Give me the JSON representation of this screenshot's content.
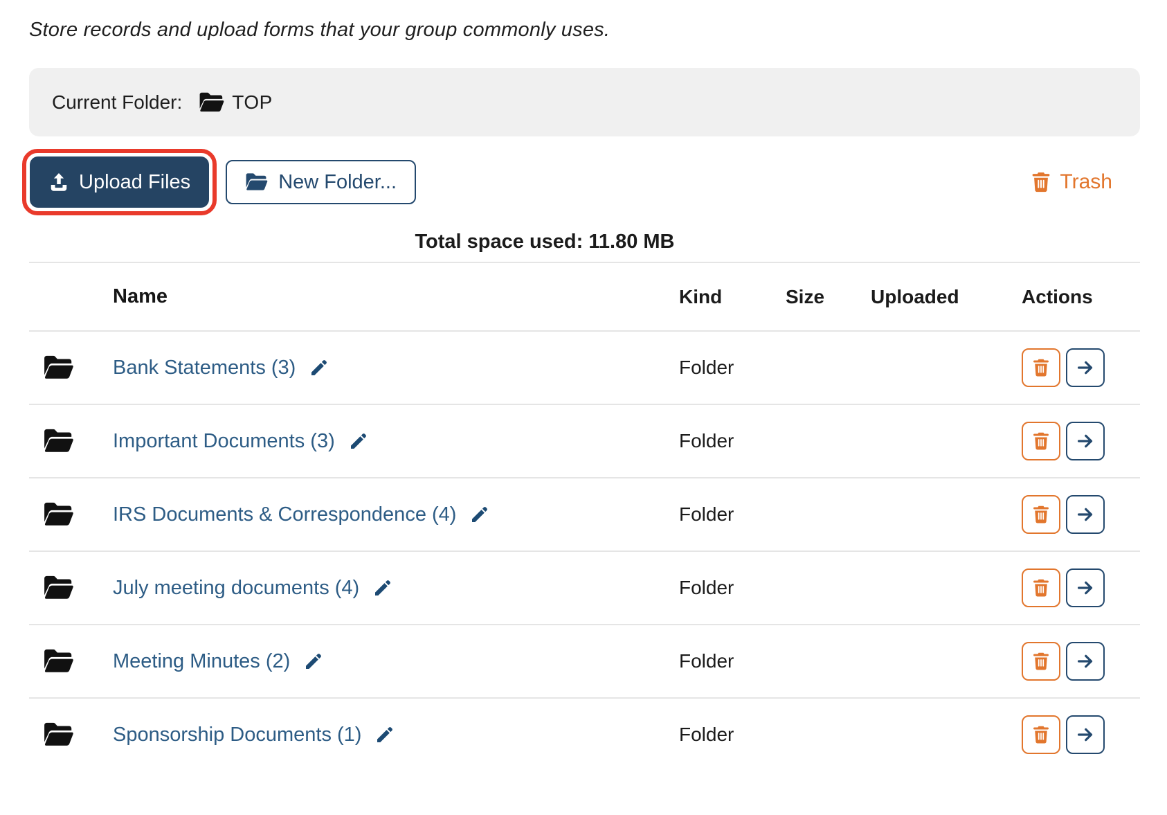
{
  "intro_text": "Store records and upload forms that your group commonly uses.",
  "current_folder": {
    "label": "Current Folder:",
    "name": "TOP"
  },
  "toolbar": {
    "upload_label": "Upload Files",
    "new_folder_label": "New Folder...",
    "trash_label": "Trash"
  },
  "summary": {
    "total_space_text": "Total space used: 11.80 MB"
  },
  "colors": {
    "primary_navy": "#254463",
    "outline_navy": "#24496e",
    "link_blue": "#2d5c85",
    "accent_orange": "#e2762d",
    "highlight_red": "#e93a2b",
    "bar_gray": "#f0f0f0"
  },
  "icons": [
    "upload-icon",
    "open-folder-icon",
    "trash-icon",
    "pencil-icon",
    "arrow-right-icon"
  ],
  "table": {
    "headers": {
      "name": "Name",
      "kind": "Kind",
      "size": "Size",
      "uploaded": "Uploaded",
      "actions": "Actions"
    },
    "rows": [
      {
        "name": "Bank Statements (3)",
        "kind": "Folder",
        "size": "",
        "uploaded": ""
      },
      {
        "name": "Important Documents (3)",
        "kind": "Folder",
        "size": "",
        "uploaded": ""
      },
      {
        "name": "IRS Documents & Correspondence (4)",
        "kind": "Folder",
        "size": "",
        "uploaded": ""
      },
      {
        "name": "July meeting documents (4)",
        "kind": "Folder",
        "size": "",
        "uploaded": ""
      },
      {
        "name": "Meeting Minutes (2)",
        "kind": "Folder",
        "size": "",
        "uploaded": ""
      },
      {
        "name": "Sponsorship Documents (1)",
        "kind": "Folder",
        "size": "",
        "uploaded": ""
      }
    ]
  }
}
